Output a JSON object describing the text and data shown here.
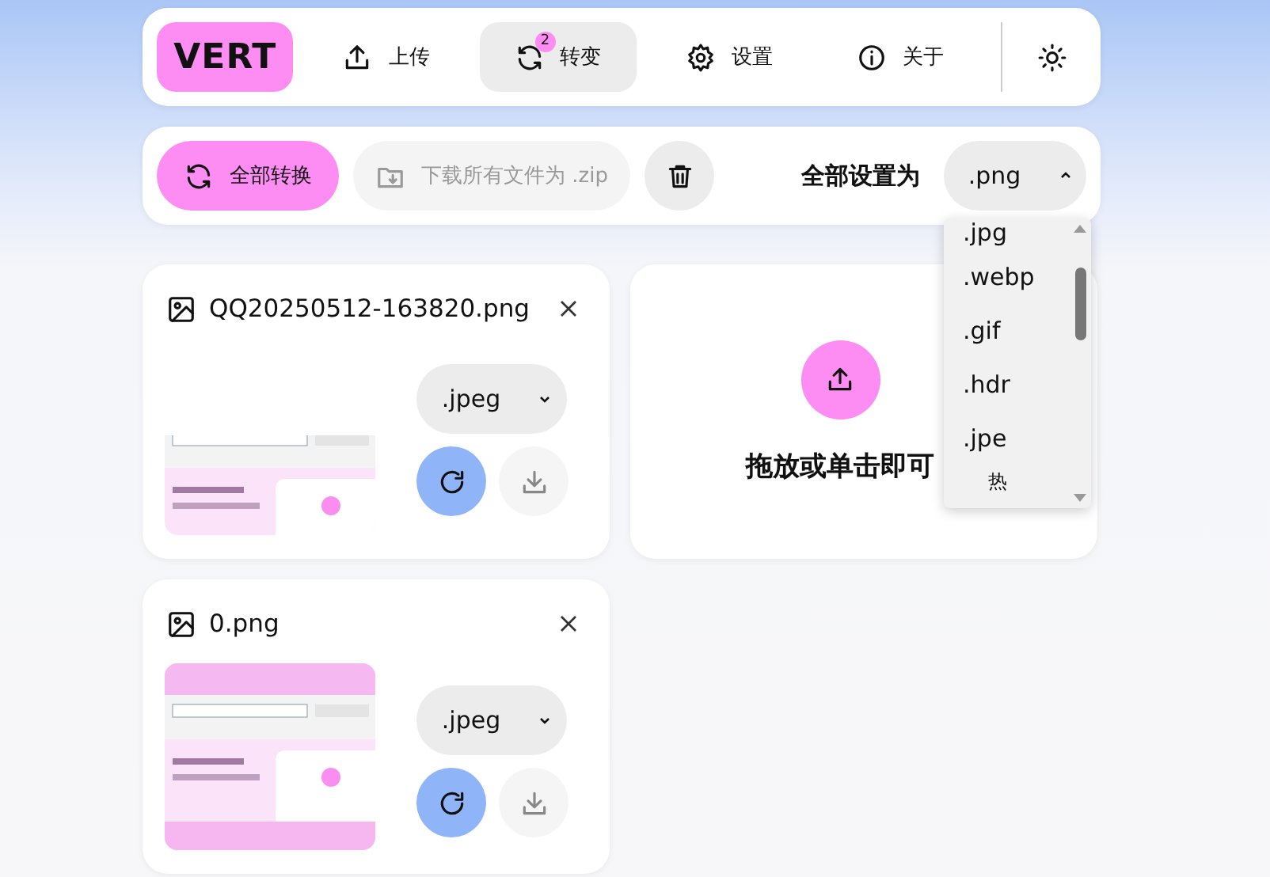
{
  "nav": {
    "logo": "VERT",
    "tabs": [
      {
        "label": "上传",
        "selected": false
      },
      {
        "label": "转变",
        "selected": true,
        "badge": "2"
      },
      {
        "label": "设置",
        "selected": false
      },
      {
        "label": "关于",
        "selected": false
      }
    ]
  },
  "toolbar": {
    "convert_all": "全部转换",
    "download_all": {
      "label": "下载所有文件为 .zip",
      "disabled": true
    },
    "set_all_label": "全部设置为",
    "set_all_value": ".png",
    "dropdown_open": true
  },
  "dropdown": {
    "options": [
      {
        "label": ".jpg",
        "kind": "option"
      },
      {
        "label": ".webp",
        "kind": "option"
      },
      {
        "label": ".gif",
        "kind": "option"
      },
      {
        "label": ".hdr",
        "kind": "option"
      },
      {
        "label": ".jpe",
        "kind": "option"
      },
      {
        "label": "热",
        "kind": "heading"
      }
    ]
  },
  "files": [
    {
      "name": "QQ20250512-163820.png",
      "format": ".jpeg",
      "download_disabled": true
    },
    {
      "name": "0.png",
      "format": ".jpeg",
      "download_disabled": true
    }
  ],
  "dropzone": {
    "text": "拖放或单击即可"
  }
}
